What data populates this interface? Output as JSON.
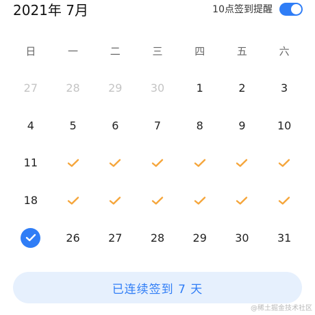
{
  "header": {
    "month_title": "2021年 7月",
    "reminder_label": "10点签到提醒",
    "reminder_enabled": true
  },
  "weekdays": [
    "日",
    "一",
    "二",
    "三",
    "四",
    "五",
    "六"
  ],
  "days": [
    {
      "label": "27",
      "state": "outside"
    },
    {
      "label": "28",
      "state": "outside"
    },
    {
      "label": "29",
      "state": "outside"
    },
    {
      "label": "30",
      "state": "outside"
    },
    {
      "label": "1",
      "state": "normal"
    },
    {
      "label": "2",
      "state": "normal"
    },
    {
      "label": "3",
      "state": "normal"
    },
    {
      "label": "4",
      "state": "normal"
    },
    {
      "label": "5",
      "state": "normal"
    },
    {
      "label": "6",
      "state": "normal"
    },
    {
      "label": "7",
      "state": "normal"
    },
    {
      "label": "8",
      "state": "normal"
    },
    {
      "label": "9",
      "state": "normal"
    },
    {
      "label": "10",
      "state": "normal"
    },
    {
      "label": "11",
      "state": "normal"
    },
    {
      "label": "",
      "state": "checked"
    },
    {
      "label": "",
      "state": "checked"
    },
    {
      "label": "",
      "state": "checked"
    },
    {
      "label": "",
      "state": "checked"
    },
    {
      "label": "",
      "state": "checked"
    },
    {
      "label": "",
      "state": "checked"
    },
    {
      "label": "18",
      "state": "normal"
    },
    {
      "label": "",
      "state": "checked"
    },
    {
      "label": "",
      "state": "checked"
    },
    {
      "label": "",
      "state": "checked"
    },
    {
      "label": "",
      "state": "checked"
    },
    {
      "label": "",
      "state": "checked"
    },
    {
      "label": "",
      "state": "checked"
    },
    {
      "label": "",
      "state": "today"
    },
    {
      "label": "26",
      "state": "normal"
    },
    {
      "label": "27",
      "state": "normal"
    },
    {
      "label": "28",
      "state": "normal"
    },
    {
      "label": "29",
      "state": "normal"
    },
    {
      "label": "30",
      "state": "normal"
    },
    {
      "label": "31",
      "state": "normal"
    }
  ],
  "streak_button_label": "已连续签到  7  天",
  "watermark": "@稀土掘金技术社区",
  "colors": {
    "accent": "#2f7df6",
    "check": "#f5a53a",
    "button_bg": "#e6f0fd",
    "outside_text": "#c4c4c4"
  }
}
